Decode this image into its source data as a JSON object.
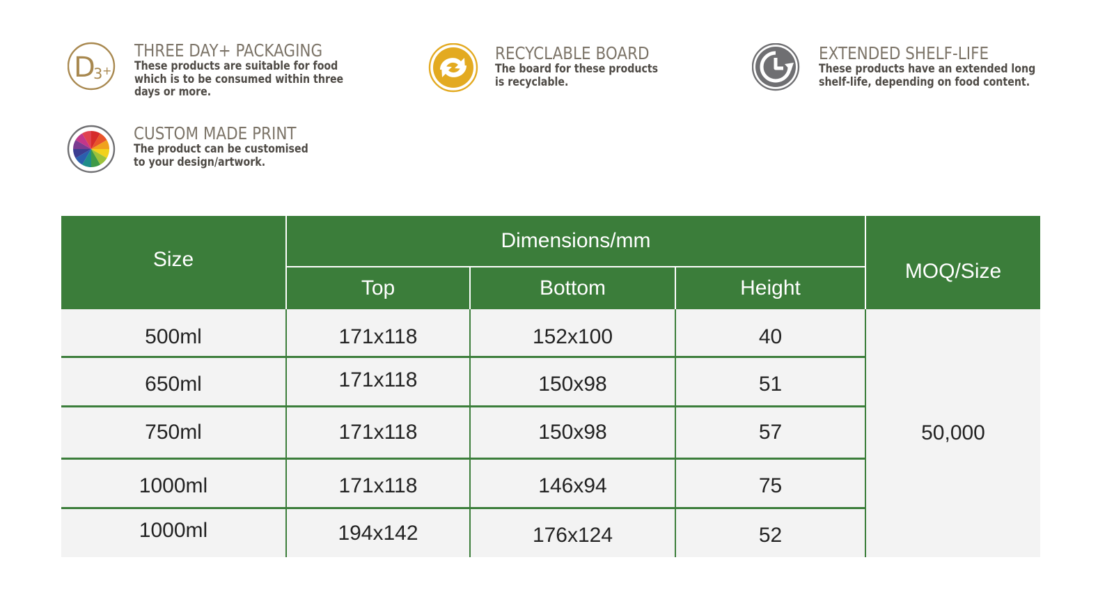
{
  "features": [
    {
      "id": "three-day",
      "icon": "d3-plus-icon",
      "title": "THREE DAY+ PACKAGING",
      "description": [
        "These products are suitable for food",
        "which is to be consumed within three",
        "days or more."
      ]
    },
    {
      "id": "recyclable",
      "icon": "recycle-icon",
      "title": "RECYCLABLE BOARD",
      "description": [
        "The board for these products",
        "is recyclable."
      ]
    },
    {
      "id": "shelf-life",
      "icon": "clock-icon",
      "title": "EXTENDED SHELF-LIFE",
      "description": [
        "These products have an extended long",
        "shelf-life, depending on food content."
      ]
    },
    {
      "id": "custom-print",
      "icon": "color-wheel-icon",
      "title": "CUSTOM MADE PRINT",
      "description": [
        "The product can be customised",
        "to your design/artwork."
      ]
    }
  ],
  "table": {
    "headers": {
      "size": "Size",
      "dimensions": "Dimensions/mm",
      "top": "Top",
      "bottom": "Bottom",
      "height": "Height",
      "moq": "MOQ/Size"
    },
    "rows": [
      {
        "size": "500ml",
        "top": "171x118",
        "bottom": "152x100",
        "height": "40"
      },
      {
        "size": "650ml",
        "top": "171x118",
        "bottom": "150x98",
        "height": "51"
      },
      {
        "size": "750ml",
        "top": "171x118",
        "bottom": "150x98",
        "height": "57"
      },
      {
        "size": "1000ml",
        "top": "171x118",
        "bottom": "146x94",
        "height": "75"
      },
      {
        "size": "1000ml",
        "top": "194x142",
        "bottom": "176x124",
        "height": "52"
      }
    ],
    "moq_value": "50,000"
  },
  "colors": {
    "header_green": "#3b7d3a",
    "gold": "#a8884f",
    "recycle_gold": "#e3aa21",
    "clock_gray": "#6f6f72",
    "title_gray": "#7c7468"
  }
}
